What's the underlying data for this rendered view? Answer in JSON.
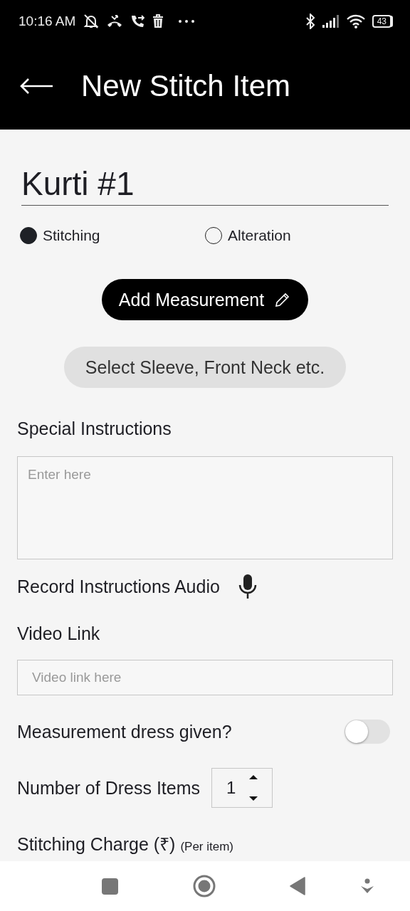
{
  "status_bar": {
    "time": "10:16 AM",
    "battery": "43"
  },
  "app_bar": {
    "title": "New Stitch Item"
  },
  "item_name": {
    "value": "Kurti #1"
  },
  "type_options": [
    {
      "label": "Stitching",
      "selected": true
    },
    {
      "label": "Alteration",
      "selected": false
    }
  ],
  "add_measurement_button": {
    "label": "Add Measurement"
  },
  "select_options_button": {
    "label": "Select Sleeve, Front Neck etc."
  },
  "special_instructions": {
    "label": "Special Instructions",
    "placeholder": "Enter here"
  },
  "record_audio": {
    "label": "Record Instructions Audio"
  },
  "video_link": {
    "label": "Video Link",
    "placeholder": "Video link here"
  },
  "measurement_dress": {
    "label": "Measurement dress given?",
    "on": false
  },
  "dress_items": {
    "label": "Number of Dress Items",
    "value": "1"
  },
  "stitching_charge": {
    "label": "Stitching Charge (₹)",
    "note": "(Per item)"
  }
}
